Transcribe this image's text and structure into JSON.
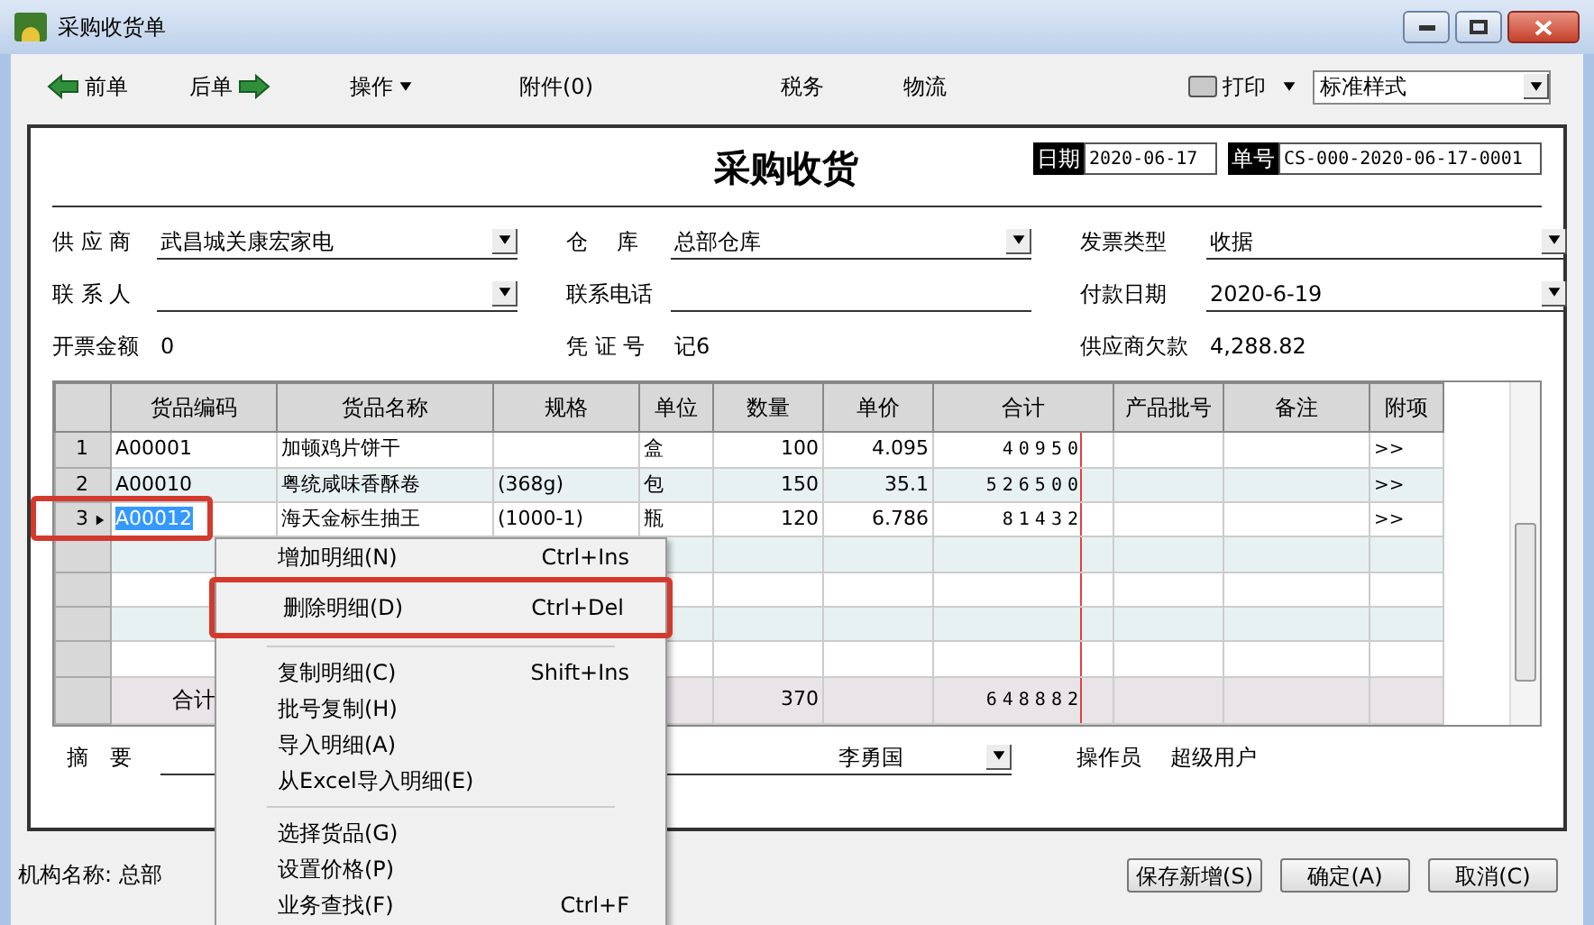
{
  "window": {
    "title": "采购收货单"
  },
  "toolbar": {
    "items": [
      {
        "label": "前单",
        "kind": "prev"
      },
      {
        "label": "后单",
        "kind": "next"
      },
      {
        "label": "操作",
        "kind": "menu"
      },
      {
        "label": "附件(0)",
        "kind": "plain"
      },
      {
        "label": "税务",
        "kind": "plain"
      },
      {
        "label": "物流",
        "kind": "plain"
      }
    ],
    "print": {
      "label": "打印"
    },
    "style_select": {
      "value": "标准样式"
    }
  },
  "form": {
    "title": "采购收货",
    "date": {
      "label": "日期",
      "value": "2020-06-17"
    },
    "number": {
      "label": "单号",
      "value": "CS-000-2020-06-17-0001"
    },
    "fields": [
      {
        "label": "供 应 商",
        "value": "武昌城关康宏家电",
        "kind": "combo"
      },
      {
        "label": "仓　 库",
        "value": "总部仓库",
        "kind": "combo"
      },
      {
        "label": "发票类型",
        "value": "收据",
        "kind": "combo"
      },
      {
        "label": "联 系 人",
        "kind": "combo"
      },
      {
        "label": "联系电话",
        "kind": "text"
      },
      {
        "label": "付款日期",
        "value": "2020-6-19",
        "kind": "combo"
      },
      {
        "label": "开票金额",
        "value": "0",
        "kind": "plain"
      },
      {
        "label": "凭 证 号",
        "value": "记6",
        "kind": "plain"
      },
      {
        "label": "供应商欠款",
        "value": "4,288.82",
        "kind": "plain"
      }
    ]
  },
  "table": {
    "columns": [
      "货品编码",
      "货品名称",
      "规格",
      "单位",
      "数量",
      "单价",
      "合计",
      "产品批号",
      "备注",
      "附项"
    ],
    "rows": [
      {
        "number": "1",
        "selected": false,
        "cells": [
          "A00001",
          "加顿鸡片饼干",
          "",
          "盒",
          "100",
          "4.095",
          "40950",
          "",
          "",
          ">>"
        ]
      },
      {
        "number": "2",
        "selected": false,
        "cells": [
          "A00010",
          "粤统咸味香酥卷",
          "(368g)",
          "包",
          "150",
          "35.1",
          "526500",
          "",
          "",
          ">>"
        ]
      },
      {
        "number": "3",
        "selected": true,
        "cells": [
          "A00012",
          "海天金标生抽王",
          "(1000-1)",
          "瓶",
          "120",
          "6.786",
          "81432",
          "",
          "",
          ">>"
        ]
      }
    ],
    "total": {
      "label": "合计",
      "quantity": "370",
      "amount": "648882"
    }
  },
  "summary": {
    "label": "摘　要",
    "handler": "李勇国",
    "operator_label": "操作员",
    "operator": "超级用户"
  },
  "context_menu": {
    "items": [
      {
        "kind": "item",
        "label": "增加明细(N)",
        "shortcut": "Ctrl+Ins"
      },
      {
        "kind": "item",
        "label": "删除明细(D)",
        "shortcut": "Ctrl+Del"
      },
      {
        "kind": "separator"
      },
      {
        "kind": "item",
        "label": "复制明细(C)",
        "shortcut": "Shift+Ins"
      },
      {
        "kind": "item",
        "label": "批号复制(H)"
      },
      {
        "kind": "item",
        "label": "导入明细(A)"
      },
      {
        "kind": "item",
        "label": "从Excel导入明细(E)"
      },
      {
        "kind": "separator"
      },
      {
        "kind": "item",
        "label": "选择货品(G)"
      },
      {
        "kind": "item",
        "label": "设置价格(P)"
      },
      {
        "kind": "item",
        "label": "业务查找(F)",
        "shortcut": "Ctrl+F"
      }
    ]
  },
  "status_bar": {
    "org": "机构名称: 总部",
    "buttons": [
      "保存新增(S)",
      "确定(A)",
      "取消(C)"
    ]
  }
}
